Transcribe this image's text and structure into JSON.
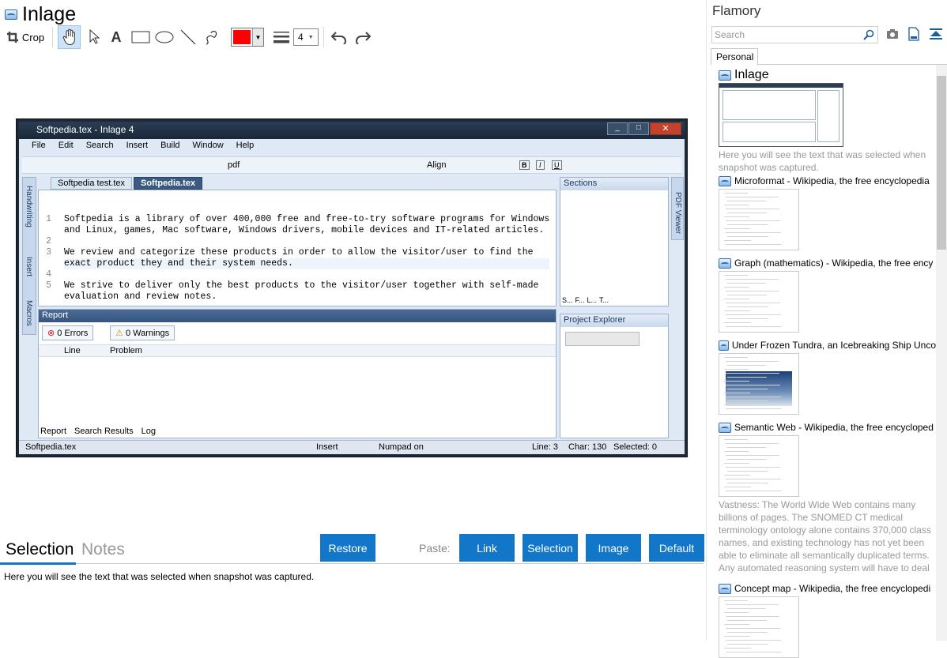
{
  "app": {
    "title": "Inlage"
  },
  "toolbar": {
    "crop_label": "Crop",
    "line_width": "4"
  },
  "bottom": {
    "tab_selection": "Selection",
    "tab_notes": "Notes",
    "restore": "Restore",
    "paste_label": "Paste:",
    "link": "Link",
    "selection": "Selection",
    "image": "Image",
    "default": "Default",
    "selected_text": "Here you will see the text that was selected when snapshot was captured."
  },
  "sidebar": {
    "title": "Flamory",
    "search_placeholder": "Search",
    "tab_personal": "Personal",
    "items": [
      {
        "title": "Inlage",
        "desc": "Here you will see the text that was selected when snapshot was captured."
      },
      {
        "title": "Microformat - Wikipedia, the free encyclopedia"
      },
      {
        "title": "Graph (mathematics) - Wikipedia, the free ency"
      },
      {
        "title": "Under Frozen Tundra, an Icebreaking Ship Unco"
      },
      {
        "title": "Semantic Web - Wikipedia, the free encycloped",
        "desc": "Vastness: The World Wide Web contains many billions of pages. The SNOMED CT medical terminology ontology alone contains 370,000 class names, and existing technology has not yet been able to eliminate all semantically duplicated terms. Any automated reasoning system will have to deal with truly huge inputs."
      },
      {
        "title": "Concept map - Wikipedia, the free encyclopedi"
      }
    ]
  },
  "snapshot": {
    "window_title": "Softpedia.tex - Inlage 4",
    "menu": [
      "File",
      "Edit",
      "Search",
      "Insert",
      "Build",
      "Window",
      "Help"
    ],
    "output_format": "pdf",
    "align": "Align",
    "tabs": [
      "Softpedia test.tex",
      "Softpedia.tex"
    ],
    "side_tabs": [
      "Handwriting",
      "Insert",
      "Macros"
    ],
    "pdf_viewer": "PDF Viewer",
    "line_numbers": [
      "1",
      "",
      "2",
      "3",
      "",
      "4",
      "5",
      ""
    ],
    "code_lines": [
      "Softpedia is a library of over 400,000 free and free-to-try software programs for Windows",
      "and Linux, games, Mac software, Windows drivers, mobile devices and IT-related articles.",
      "",
      "We review and categorize these products in order to allow the visitor/user to find the",
      "exact product they and their system needs.",
      "",
      "We strive to deliver only the best products to the visitor/user together with self-made",
      "evaluation and review notes."
    ],
    "sections": "Sections",
    "project_explorer": "Project Explorer",
    "report": "Report",
    "errors": "0 Errors",
    "warnings": "0 Warnings",
    "col_line": "Line",
    "col_problem": "Problem",
    "bottom_tabs": [
      "Report",
      "Search Results",
      "Log"
    ],
    "section_tabs": [
      "S...",
      "F...",
      "L...",
      "T..."
    ],
    "status": {
      "file": "Softpedia.tex",
      "mode": "Insert",
      "numpad": "Numpad on",
      "line": "Line: 3",
      "char": "Char: 130",
      "selected": "Selected: 0"
    }
  },
  "colors": {
    "accent": "#1277c9",
    "pen": "#ff0000"
  }
}
